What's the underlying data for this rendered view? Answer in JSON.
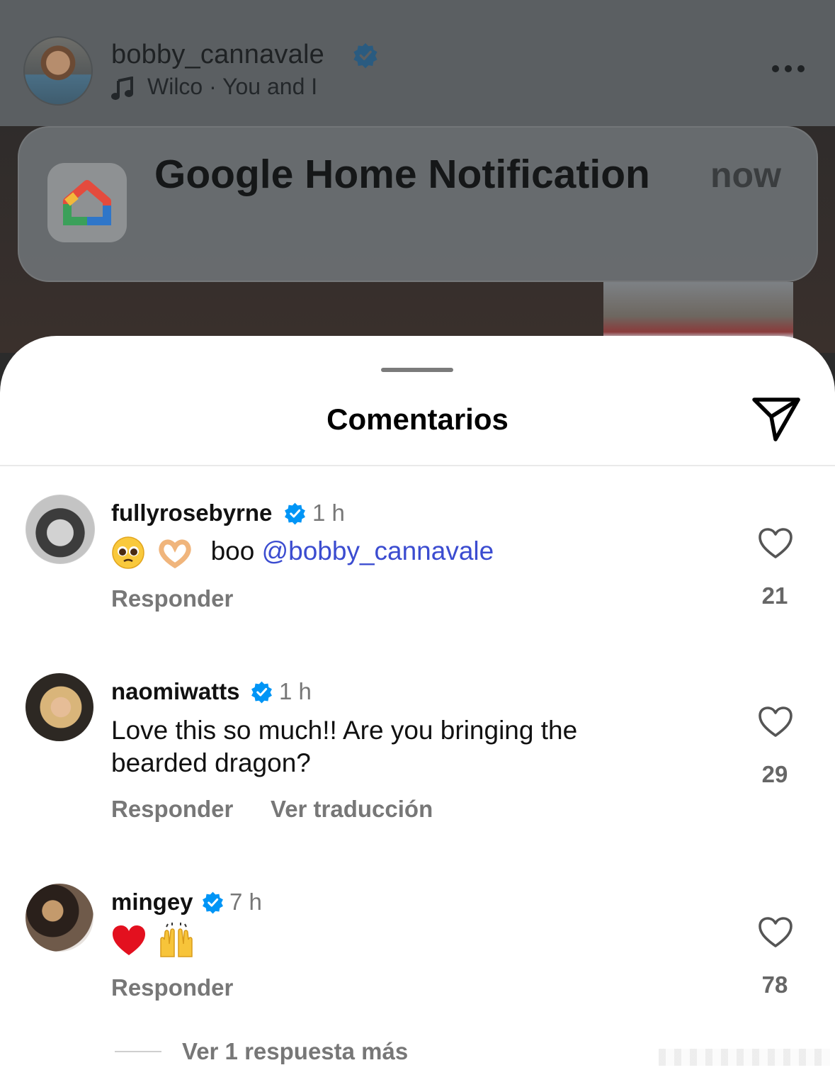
{
  "post": {
    "username": "bobby_cannavale",
    "music": "Wilco · You and I"
  },
  "notification": {
    "title": "Google Home Notification",
    "time": "now"
  },
  "sheet": {
    "title": "Comentarios"
  },
  "comments": [
    {
      "username": "fullyrosebyrne",
      "time": "1 h",
      "text_prefix": "boo",
      "mention": "@bobby_cannavale",
      "emojis": [
        "pleading-face",
        "heart-hands"
      ],
      "reply_label": "Responder",
      "likes": "21"
    },
    {
      "username": "naomiwatts",
      "time": "1 h",
      "text_line1": "Love this so much!! Are you bringing the",
      "text_line2": "bearded dragon?",
      "reply_label": "Responder",
      "translate_label": "Ver traducción",
      "likes": "29"
    },
    {
      "username": "mingey",
      "time": "7 h",
      "emojis": [
        "red-heart",
        "raising-hands"
      ],
      "reply_label": "Responder",
      "likes": "78"
    }
  ],
  "more_replies": "Ver 1 respuesta más",
  "colors": {
    "verified": "#0095f6",
    "mention": "#3b4cd0",
    "muted_text": "#777777"
  }
}
